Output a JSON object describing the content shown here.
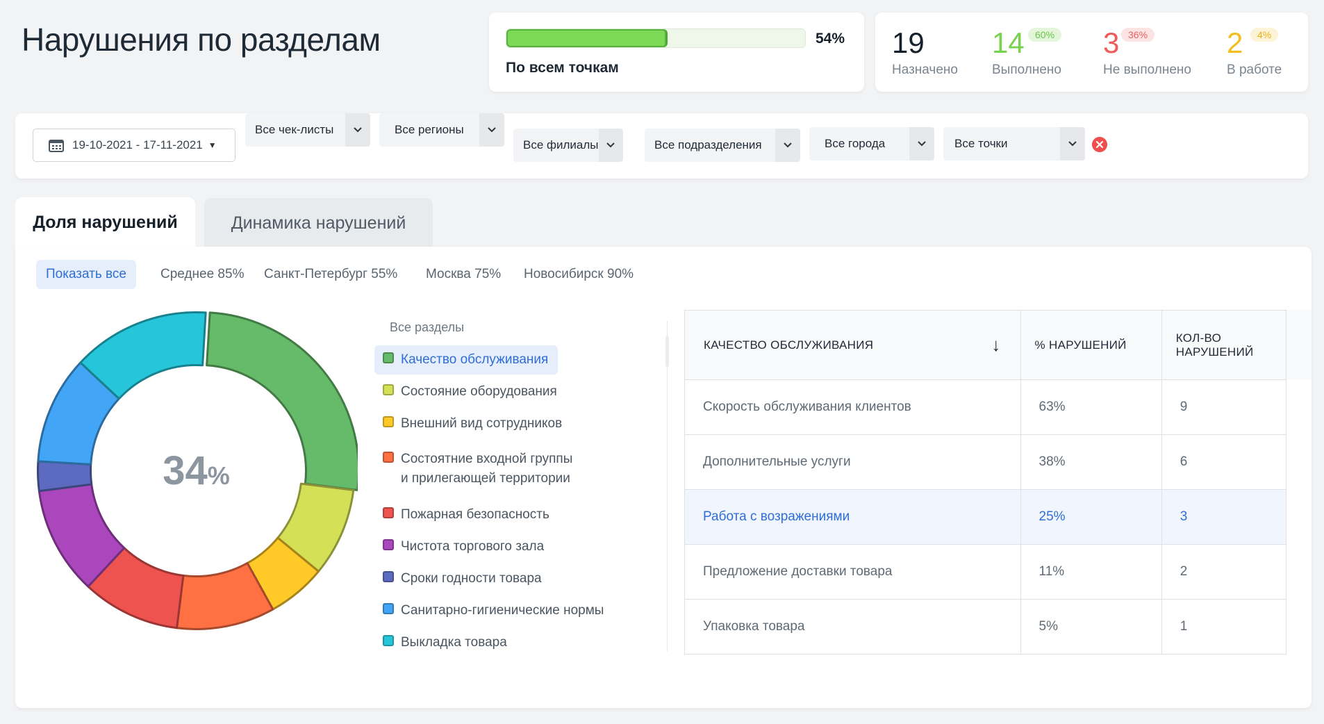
{
  "page_title": "Нарушения по разделам",
  "progress": {
    "percent_text": "54%",
    "fill_fraction": 0.54,
    "label": "По всем точкам"
  },
  "stats": [
    {
      "value": "19",
      "label": "Назначено",
      "badge": "",
      "color": "#16202a"
    },
    {
      "value": "14",
      "label": "Выполнено",
      "badge": "60%",
      "color": "#78d14f"
    },
    {
      "value": "3",
      "label": "Не выполнено",
      "badge": "36%",
      "color": "#ef5b5b"
    },
    {
      "value": "2",
      "label": "В работе",
      "badge": "4%",
      "color": "#f3bf1d"
    }
  ],
  "filters": {
    "date_range": "19-10-2021 - 17-11-2021",
    "selects": [
      "Все чек-листы",
      "Все регионы",
      "Все филиалы",
      "Все подразделения",
      "Все города",
      "Все точки"
    ]
  },
  "tabs": {
    "active": "Доля нарушений",
    "inactive": "Динамика нарушений"
  },
  "city_filters": [
    "Показать все",
    "Среднее 85%",
    "Санкт-Петербург 55%",
    "Москва 75%",
    "Новосибирск 90%"
  ],
  "chart_data": {
    "type": "pie",
    "center_value": "34",
    "center_unit": "%",
    "legend_title": "Все разделы",
    "slices": [
      {
        "label": "Качество обслуживания",
        "color": "#66bb6a",
        "value": 26
      },
      {
        "label": "Состояние оборудования",
        "color": "#d4e157",
        "value": 9
      },
      {
        "label": "Внешний вид сотрудников",
        "color": "#ffca28",
        "value": 6
      },
      {
        "label": "Состоятние входной группы\nи прилегающей территории",
        "color": "#ff7043",
        "value": 10
      },
      {
        "label": "Пожарная безопасность",
        "color": "#ef5350",
        "value": 10
      },
      {
        "label": "Чистота торгового зала",
        "color": "#ab47bc",
        "value": 11
      },
      {
        "label": "Сроки годности товара",
        "color": "#5c6bc0",
        "value": 3
      },
      {
        "label": "Санитарно-гигиенические нормы",
        "color": "#42a5f5",
        "value": 11
      },
      {
        "label": "Выкладка товара",
        "color": "#26c6da",
        "value": 14
      }
    ]
  },
  "table": {
    "headers": [
      "КАЧЕСТВО ОБСЛУЖИВАНИЯ",
      "% НАРУШЕНИЙ",
      "КОЛ-ВО НАРУШЕНИЙ"
    ],
    "rows": [
      [
        "Скорость обслуживания клиентов",
        "63%",
        "9"
      ],
      [
        "Дополнительные услуги",
        "38%",
        "6"
      ],
      [
        "Работа с возражениями",
        "25%",
        "3"
      ],
      [
        "Предложение доставки товара",
        "11%",
        "2"
      ],
      [
        "Упаковка товара",
        "5%",
        "1"
      ]
    ]
  }
}
